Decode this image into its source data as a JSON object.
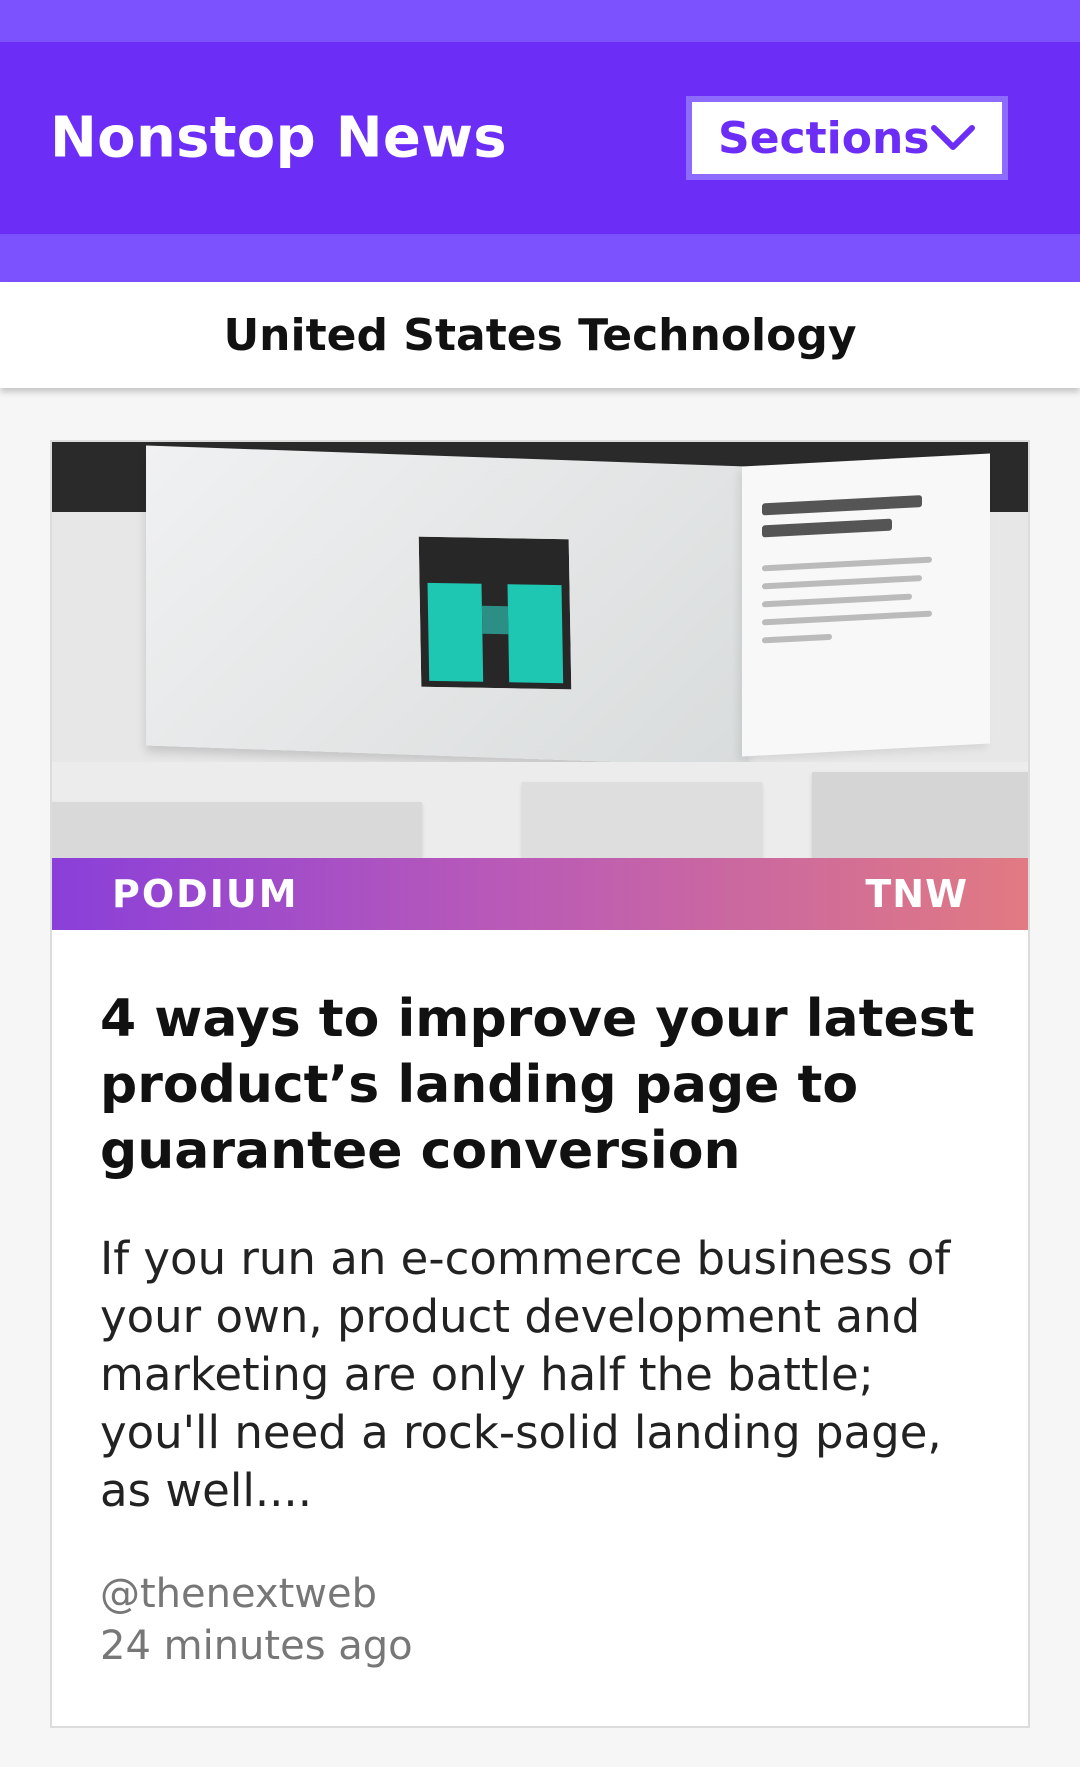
{
  "app": {
    "title": "Nonstop News",
    "sections_label": "Sections",
    "accent_color": "#6c2ef7"
  },
  "subheader": {
    "title": "United States Technology"
  },
  "article": {
    "image_logos": {
      "left": "PODIUM",
      "right": "TNW"
    },
    "headline": "4 ways to improve your latest product’s landing page to guarantee conversion",
    "excerpt": "If you run an e-commerce business of your own, product development and marketing are only half the battle; you'll need a rock-solid landing page, as well....",
    "source": "@thenextweb",
    "time": "24 minutes ago"
  }
}
